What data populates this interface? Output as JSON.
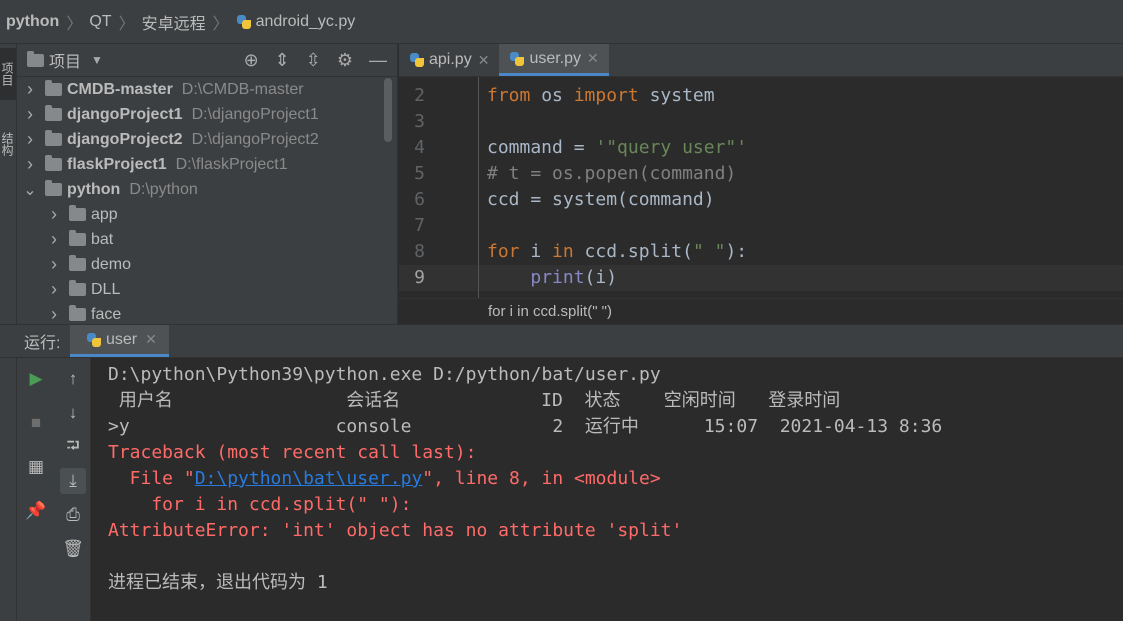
{
  "breadcrumb": [
    "python",
    "QT",
    "安卓远程",
    "android_yc.py"
  ],
  "left_strip": {
    "project_tab": "项目",
    "structure_tab": "结构"
  },
  "project": {
    "title": "项目",
    "items": [
      {
        "name": "CMDB-master",
        "path": "D:\\CMDB-master",
        "bold": true,
        "expanded": false,
        "level": 0
      },
      {
        "name": "djangoProject1",
        "path": "D:\\djangoProject1",
        "bold": true,
        "expanded": false,
        "level": 0
      },
      {
        "name": "djangoProject2",
        "path": "D:\\djangoProject2",
        "bold": true,
        "expanded": false,
        "level": 0
      },
      {
        "name": "flaskProject1",
        "path": "D:\\flaskProject1",
        "bold": true,
        "expanded": false,
        "level": 0
      },
      {
        "name": "python",
        "path": "D:\\python",
        "bold": true,
        "expanded": true,
        "level": 0
      },
      {
        "name": "app",
        "path": "",
        "bold": false,
        "expanded": false,
        "level": 1
      },
      {
        "name": "bat",
        "path": "",
        "bold": false,
        "expanded": false,
        "level": 1
      },
      {
        "name": "demo",
        "path": "",
        "bold": false,
        "expanded": false,
        "level": 1
      },
      {
        "name": "DLL",
        "path": "",
        "bold": false,
        "expanded": false,
        "level": 1
      },
      {
        "name": "face",
        "path": "",
        "bold": false,
        "expanded": false,
        "level": 1
      }
    ]
  },
  "editor": {
    "tabs": [
      {
        "label": "api.py",
        "active": false
      },
      {
        "label": "user.py",
        "active": true
      }
    ],
    "lines": [
      {
        "num": "2",
        "text": "from os import system"
      },
      {
        "num": "3",
        "text": ""
      },
      {
        "num": "4",
        "text": "command = '\"query user\"'"
      },
      {
        "num": "5",
        "text": "# t = os.popen(command)"
      },
      {
        "num": "6",
        "text": "ccd = system(command)"
      },
      {
        "num": "7",
        "text": ""
      },
      {
        "num": "8",
        "text": "for i in ccd.split(\" \"):"
      },
      {
        "num": "9",
        "text": "    print(i)"
      }
    ],
    "hint": "for i in ccd.split(\" \")"
  },
  "run": {
    "label": "运行:",
    "tab": "user",
    "output": [
      {
        "text": "D:\\python\\Python39\\python.exe D:/python/bat/user.py",
        "type": "normal"
      },
      {
        "text": " 用户名                会话名             ID  状态    空闲时间   登录时间",
        "type": "normal"
      },
      {
        "text": ">y                   console             2  运行中      15:07  2021-04-13 8:36",
        "type": "normal"
      },
      {
        "text": "Traceback (most recent call last):",
        "type": "error"
      },
      {
        "text_prefix": "  File \"",
        "link": "D:\\python\\bat\\user.py",
        "text_suffix": "\", line 8, in <module>",
        "type": "error-link"
      },
      {
        "text": "    for i in ccd.split(\" \"):",
        "type": "error"
      },
      {
        "text": "AttributeError: 'int' object has no attribute 'split'",
        "type": "error"
      },
      {
        "text": "",
        "type": "normal"
      },
      {
        "text": "进程已结束，退出代码为 1",
        "type": "normal"
      }
    ]
  },
  "colors": {
    "background": "#2b2b2b",
    "panel": "#3c3f41",
    "keyword": "#cc7832",
    "string": "#6a8759",
    "comment": "#808080",
    "builtin": "#8888c6",
    "error": "#ff6b68",
    "link": "#287bde",
    "run_green": "#499c54"
  }
}
